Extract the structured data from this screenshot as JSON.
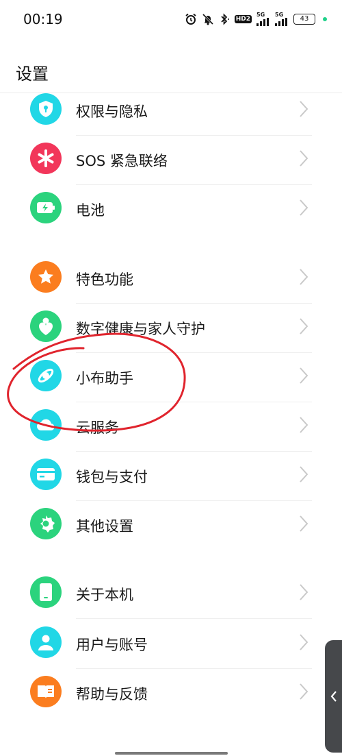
{
  "status_bar": {
    "time": "00:19",
    "network1": "5G",
    "network2": "5G",
    "hd_badge": "HD2",
    "battery": "43",
    "dot_color": "#1fd18a"
  },
  "header": {
    "title": "设置"
  },
  "items": [
    {
      "label": "权限与隐私",
      "icon": "shield-lock-icon",
      "color": "#21d7e6"
    },
    {
      "label": "SOS 紧急联络",
      "icon": "asterisk-icon",
      "color": "#f2365a"
    },
    {
      "label": "电池",
      "icon": "battery-charging-icon",
      "color": "#2bd37d"
    },
    {
      "label": "特色功能",
      "icon": "star-icon",
      "color": "#fb7d1f"
    },
    {
      "label": "数字健康与家人守护",
      "icon": "person-heart-icon",
      "color": "#2bd37d"
    },
    {
      "label": "小布助手",
      "icon": "assistant-orbit-icon",
      "color": "#21d7e6"
    },
    {
      "label": "云服务",
      "icon": "cloud-icon",
      "color": "#21d7e6"
    },
    {
      "label": "钱包与支付",
      "icon": "wallet-card-icon",
      "color": "#21d7e6"
    },
    {
      "label": "其他设置",
      "icon": "gear-icon",
      "color": "#2bd37d"
    },
    {
      "label": "关于本机",
      "icon": "phone-icon",
      "color": "#2bd37d"
    },
    {
      "label": "用户与账号",
      "icon": "user-icon",
      "color": "#21d7e6"
    },
    {
      "label": "帮助与反馈",
      "icon": "book-help-icon",
      "color": "#fb7d1f"
    }
  ],
  "annotation": {
    "color": "#e0242d"
  }
}
